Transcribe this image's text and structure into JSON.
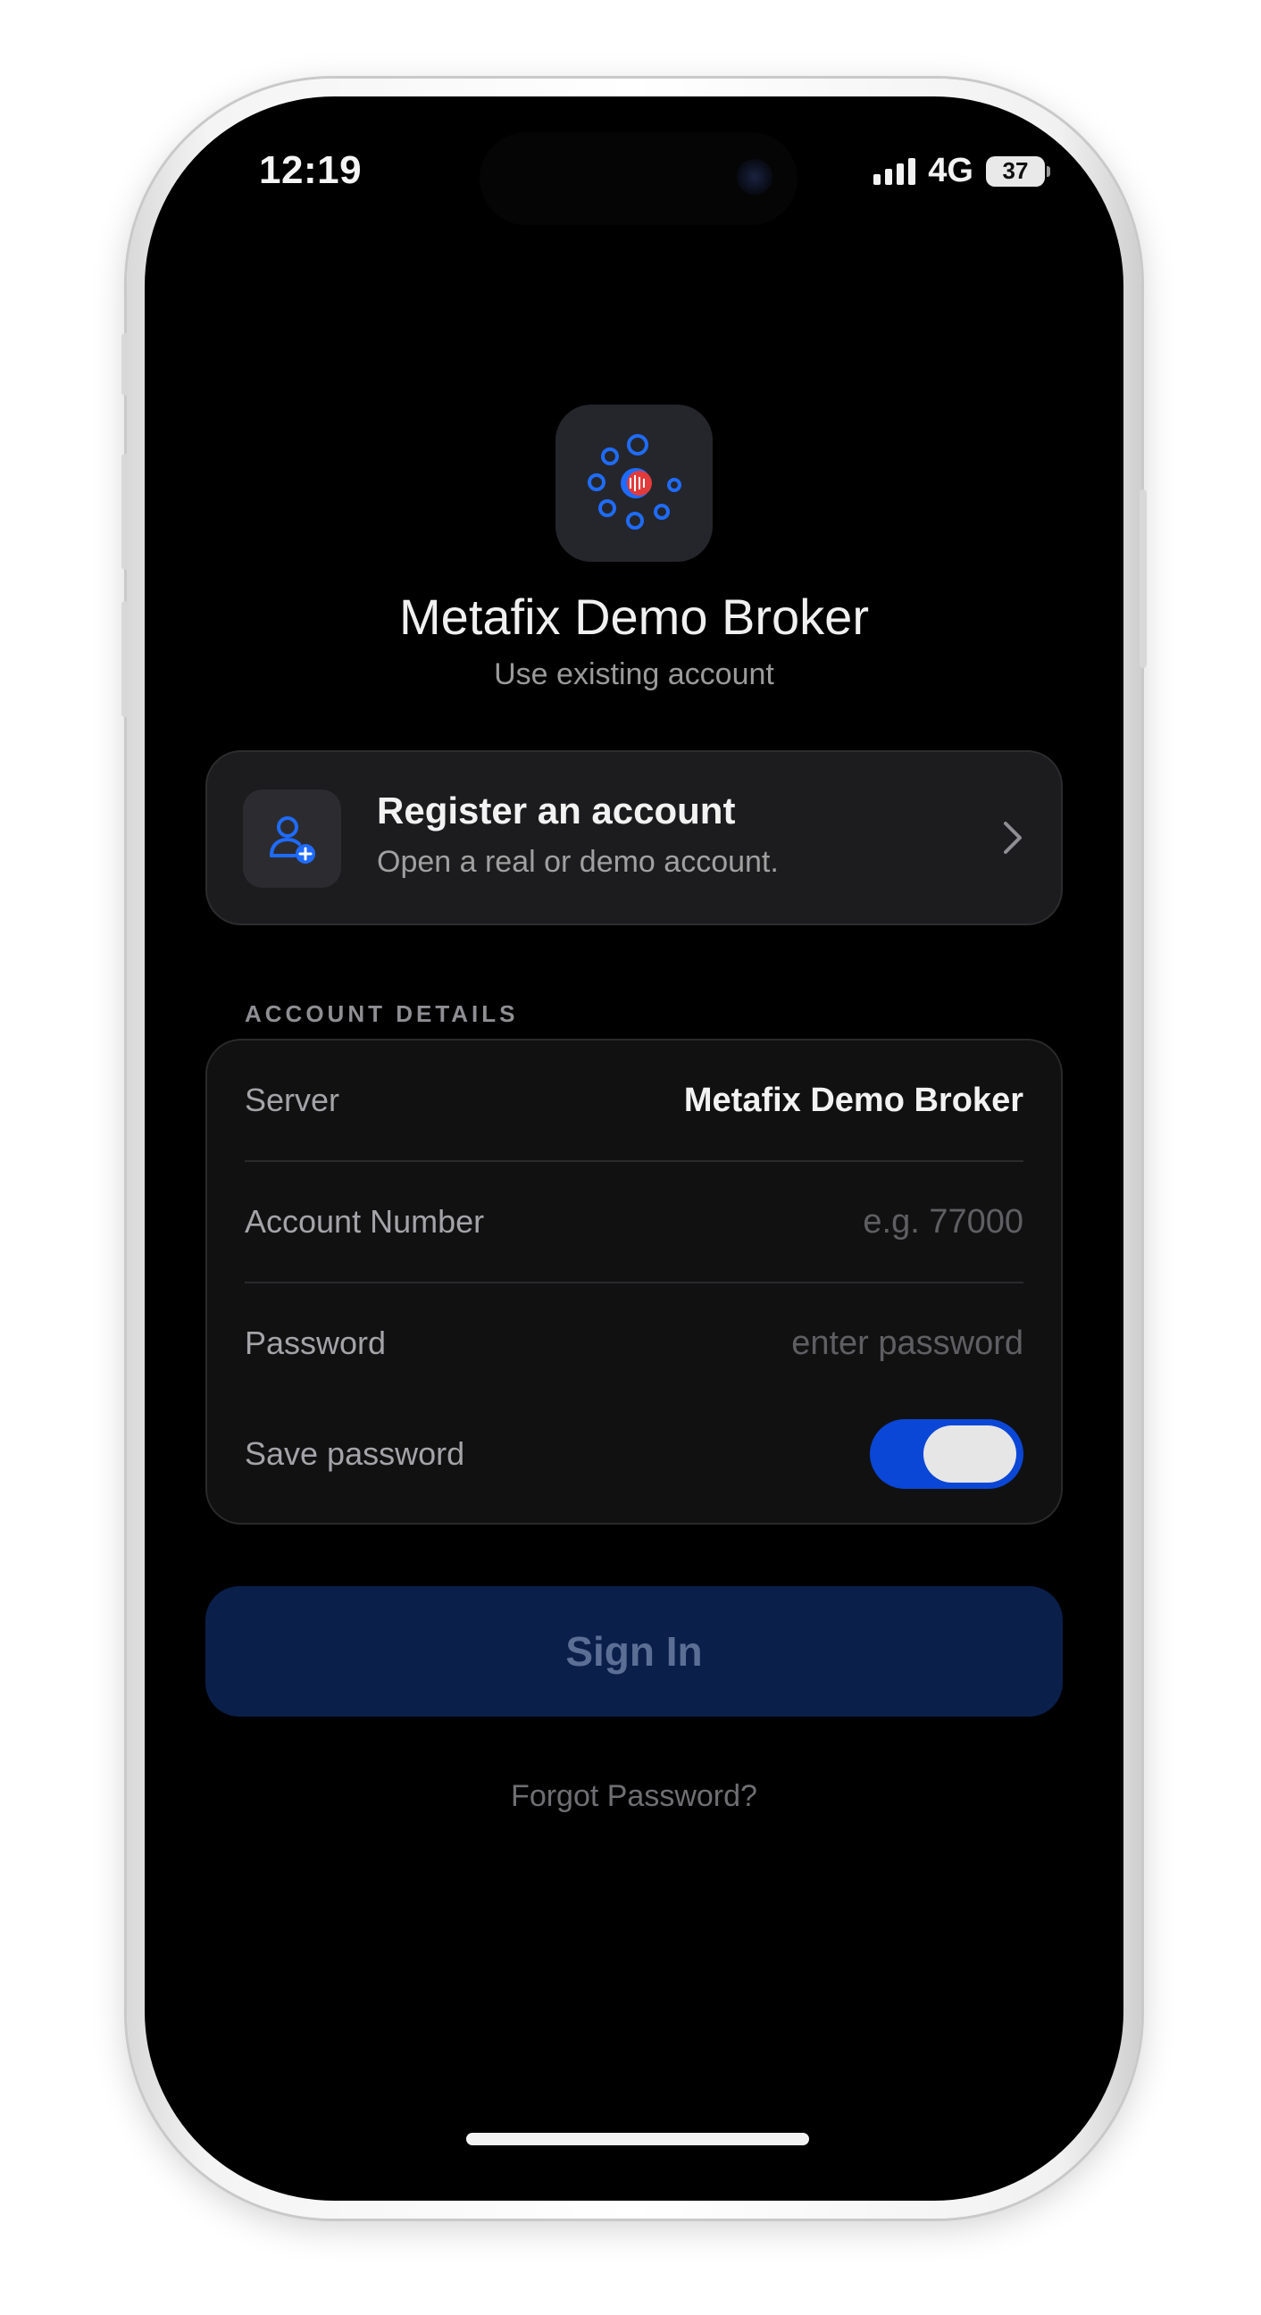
{
  "status_bar": {
    "time": "12:19",
    "network": "4G",
    "battery": "37"
  },
  "app": {
    "title": "Metafix Demo Broker",
    "subtitle": "Use existing account"
  },
  "register": {
    "title": "Register an account",
    "subtitle": "Open a real or demo account."
  },
  "section_label": "ACCOUNT DETAILS",
  "form": {
    "server_label": "Server",
    "server_value": "Metafix Demo Broker",
    "account_label": "Account Number",
    "account_placeholder": "e.g. 77000",
    "password_label": "Password",
    "password_placeholder": "enter password",
    "save_password_label": "Save password",
    "save_password_on": true
  },
  "actions": {
    "sign_in": "Sign In",
    "forgot": "Forgot Password?"
  },
  "colors": {
    "accent": "#0a47d6",
    "icon_blue": "#1f6bff",
    "icon_red": "#e23b3b",
    "signin_bg": "#0a1f4a"
  },
  "icons": {
    "app_logo": "dots-ring-logo-icon",
    "register": "add-user-icon",
    "chevron": "chevron-right-icon"
  }
}
